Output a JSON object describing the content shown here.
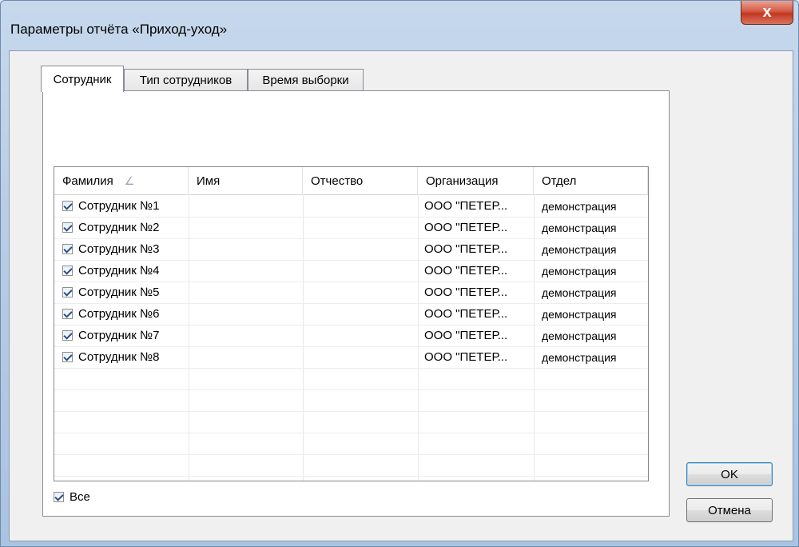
{
  "window": {
    "title": "Параметры отчёта «Приход-уход»",
    "close_glyph": "x"
  },
  "tabs": [
    {
      "label": "Сотрудник",
      "active": true
    },
    {
      "label": "Тип сотрудников",
      "active": false
    },
    {
      "label": "Время выборки",
      "active": false
    }
  ],
  "grid": {
    "columns": [
      "Фамилия",
      "Имя",
      "Отчество",
      "Организация",
      "Отдел"
    ],
    "sort_icon": "sort-ascending-icon",
    "rows": [
      {
        "checked": true,
        "lastname": "Сотрудник №1",
        "firstname": "",
        "patronymic": "",
        "org": "ООО \"ПЕТЕР...",
        "dept": "демонстрация"
      },
      {
        "checked": true,
        "lastname": "Сотрудник №2",
        "firstname": "",
        "patronymic": "",
        "org": "ООО \"ПЕТЕР...",
        "dept": "демонстрация"
      },
      {
        "checked": true,
        "lastname": "Сотрудник №3",
        "firstname": "",
        "patronymic": "",
        "org": "ООО \"ПЕТЕР...",
        "dept": "демонстрация"
      },
      {
        "checked": true,
        "lastname": "Сотрудник №4",
        "firstname": "",
        "patronymic": "",
        "org": "ООО \"ПЕТЕР...",
        "dept": "демонстрация"
      },
      {
        "checked": true,
        "lastname": "Сотрудник №5",
        "firstname": "",
        "patronymic": "",
        "org": "ООО \"ПЕТЕР...",
        "dept": "демонстрация"
      },
      {
        "checked": true,
        "lastname": "Сотрудник №6",
        "firstname": "",
        "patronymic": "",
        "org": "ООО \"ПЕТЕР...",
        "dept": "демонстрация"
      },
      {
        "checked": true,
        "lastname": "Сотрудник №7",
        "firstname": "",
        "patronymic": "",
        "org": "ООО \"ПЕТЕР...",
        "dept": "демонстрация"
      },
      {
        "checked": true,
        "lastname": "Сотрудник №8",
        "firstname": "",
        "patronymic": "",
        "org": "ООО \"ПЕТЕР...",
        "dept": "демонстрация"
      }
    ]
  },
  "all_checkbox": {
    "label": "Все",
    "checked": true
  },
  "buttons": {
    "ok": "OK",
    "cancel": "Отмена"
  }
}
